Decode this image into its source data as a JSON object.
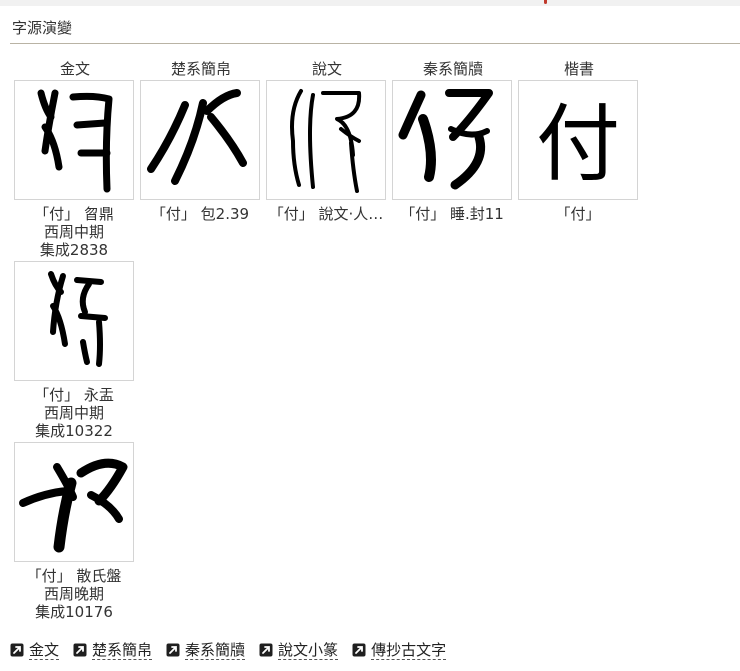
{
  "section": {
    "title": "字源演變"
  },
  "columns": [
    "金文",
    "楚系簡帛",
    "秦系簡牘",
    "說文",
    "楷書"
  ],
  "glyphs": [
    {
      "lines": [
        "「付」 曶鼎",
        "西周中期",
        "集成2838"
      ]
    },
    {
      "lines": [
        "「付」 包2.39"
      ]
    },
    {
      "lines": [
        "「付」 說文‧人…"
      ]
    },
    {
      "lines": [
        "「付」 睡.封11"
      ]
    },
    {
      "lines": [
        "「付」"
      ],
      "char": "付"
    },
    {
      "lines": [
        "「付」 永盂",
        "西周中期",
        "集成10322"
      ]
    },
    {
      "lines": [
        "「付」 散氏盤",
        "西周晚期",
        "集成10176"
      ]
    }
  ],
  "links": [
    "金文",
    "楚系簡帛",
    "秦系簡牘",
    "說文小篆",
    "傳抄古文字"
  ],
  "icons": {
    "external": "external-link-icon"
  }
}
